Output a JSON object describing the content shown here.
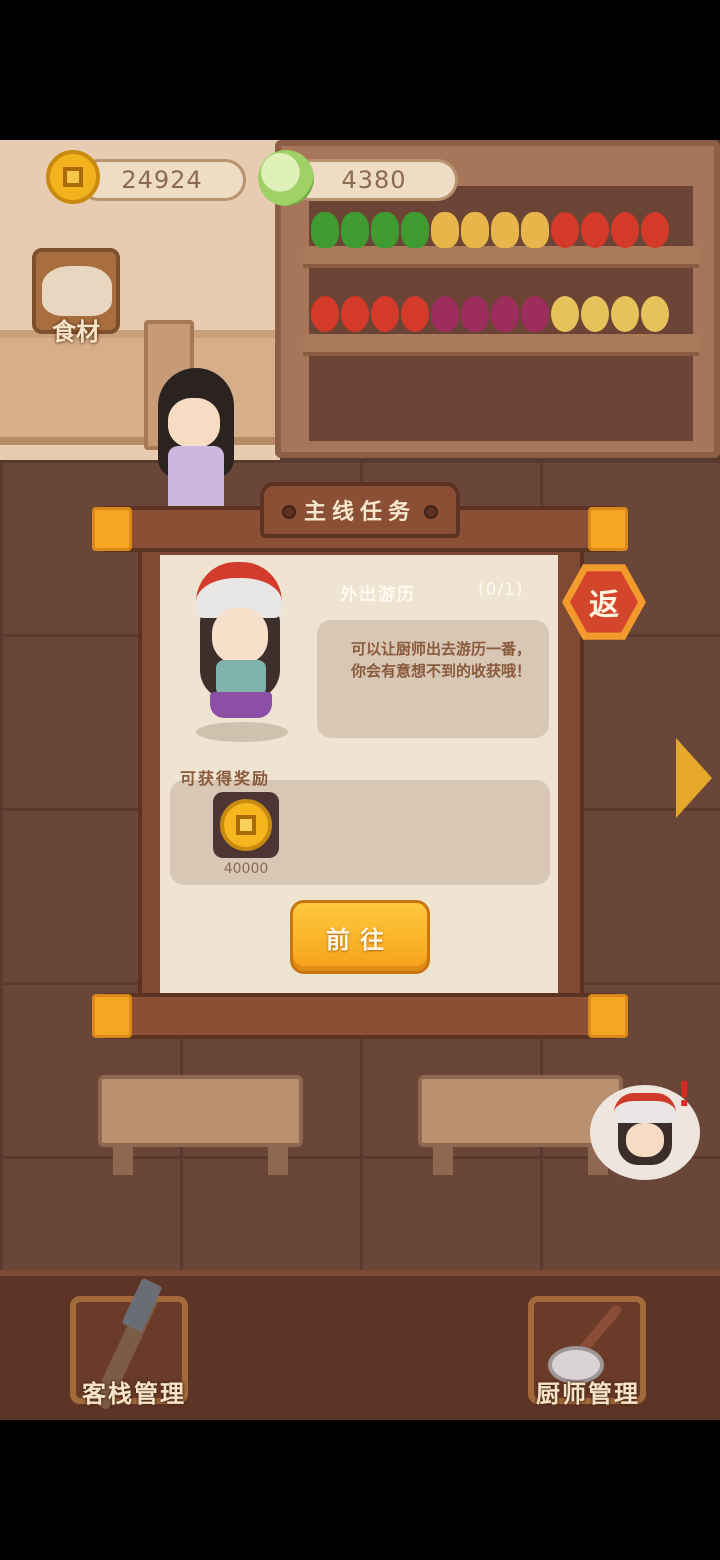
{
  "hud": {
    "coins": "24924",
    "vegetables": "4380"
  },
  "ingredients_button": {
    "label": "食材"
  },
  "quest_modal": {
    "title": "主线任务",
    "close_label": "返",
    "quest_name": "外出游历",
    "progress": "(0/1)",
    "description": "可以让厨师出去游历一番，你会有意想不到的收获哦！",
    "reward_title": "可获得奖励",
    "rewards": [
      {
        "icon": "copper-coin-icon",
        "amount": "40000"
      }
    ],
    "go_button": "前往"
  },
  "bottom_bar": {
    "inn_management": "客栈管理",
    "chef_management": "厨师管理"
  },
  "colors": {
    "accent_orange": "#f5a21a",
    "frame_brown": "#8b4f35",
    "paper": "#efe3d1"
  }
}
